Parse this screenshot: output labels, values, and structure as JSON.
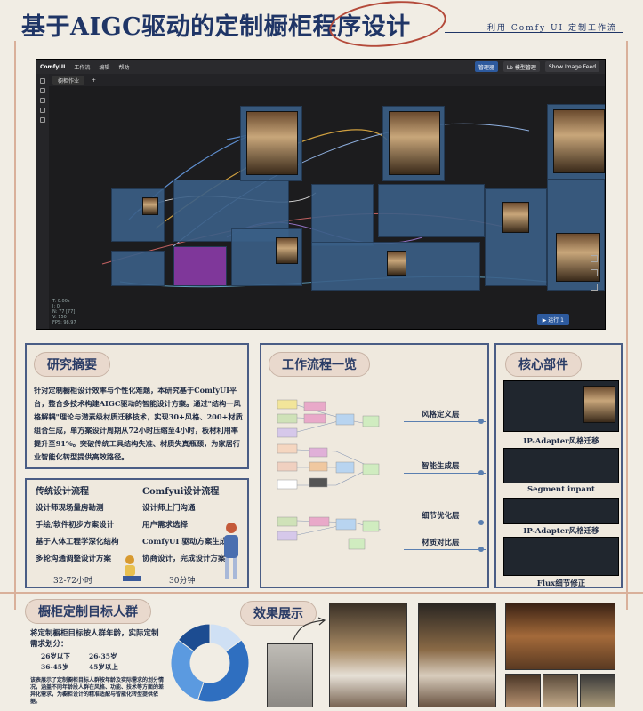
{
  "header": {
    "title": "基于AIGC驱动的定制橱柜程序设计",
    "subtitle": "利用 Comfy UI 定制工作流"
  },
  "comfyui": {
    "brand": "ComfyUI",
    "menu": [
      "工作流",
      "编辑",
      "帮助"
    ],
    "tab_label": "橱柜作业",
    "add_tab": "+",
    "manager_button": "管理器",
    "model_manager_button": "Lb 模型管理",
    "show_image_feed": "Show Image Feed",
    "run_label": "运行",
    "queue_count": "1",
    "stats": [
      "T: 0.00s",
      "I: 0",
      "N: 77 [77]",
      "V: 150",
      "FPS: 98.97"
    ],
    "accent": "#2d5a9e"
  },
  "abstract": {
    "heading": "研究摘要",
    "body": "针对定制橱柜设计效率与个性化难题，本研究基于ComfyUI平台，整合多技术构建AIGC驱动的智能设计方案。通过\"结构一风格解耦\"理论与潜素级材质迁移技术，实现30+风格、200+材质组合生成，单方案设计周期从72小时压缩至4小时，板材利用率提升至91%。突破传统工具结构失准、材质失真瓶颈，为家居行业智能化转型提供高效路径。"
  },
  "process": {
    "traditional_title": "传统设计流程",
    "traditional_steps": [
      "设计师现场量房勘测",
      "手绘/软件初步方案设计",
      "基于人体工程学深化结构",
      "多轮沟通调整设计方案"
    ],
    "traditional_time": "32-72小时",
    "comfy_title": "Comfyui设计流程",
    "comfy_steps": [
      "设计师上门沟通",
      "用户需求选择",
      "ComfyUI 驱动方案生成",
      "协商设计，完成设计方案"
    ],
    "comfy_time": "30分钟"
  },
  "workflow": {
    "heading": "工作流程一览",
    "layers": [
      "风格定义层",
      "智能生成层",
      "细节优化层",
      "材质对比层"
    ]
  },
  "core": {
    "heading": "核心部件",
    "items": [
      "IP-Adapter风格迁移",
      "Segment inpant",
      "IP-Adapter风格迁移",
      "Flux细节修正"
    ]
  },
  "target": {
    "heading": "橱柜定制目标人群",
    "intro": "将定制橱柜目标按人群年龄，实际定制需求划分：",
    "ages": [
      "26岁以下",
      "26-35岁",
      "36-45岁",
      "45岁以上"
    ],
    "note": "该表展示了定制橱柜目标人群按年龄及实际需求的划分情况，涵盖不同年龄段人群在风格、功能、技术等方面的差异化需求，为橱柜设计的精准适配与智能化转型提供依据。",
    "donut_values": [
      15,
      40,
      30,
      15
    ],
    "donut_colors": [
      "#cfe0f4",
      "#2f6fc0",
      "#5b9ae0",
      "#1c4c91"
    ]
  },
  "results": {
    "heading": "效果展示"
  }
}
